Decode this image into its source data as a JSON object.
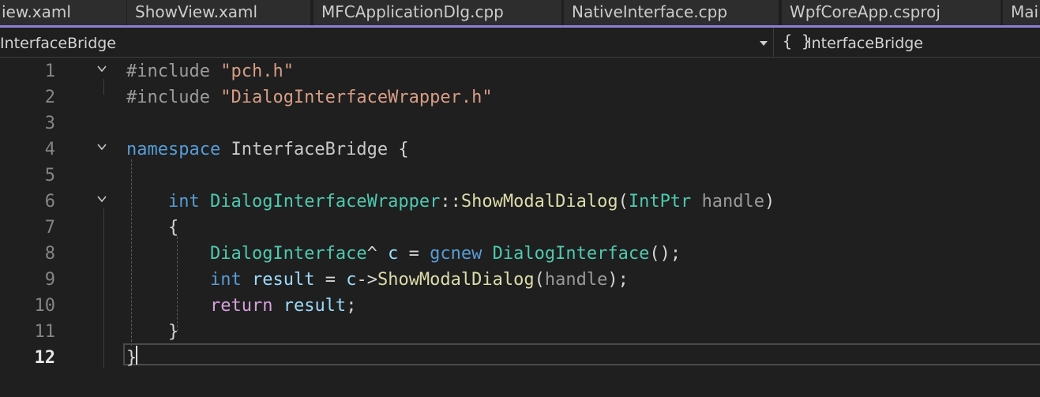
{
  "tabs": [
    {
      "label": "iew.xaml"
    },
    {
      "label": "ShowView.xaml"
    },
    {
      "label": "MFCApplicationDlg.cpp"
    },
    {
      "label": "NativeInterface.cpp"
    },
    {
      "label": "WpfCoreApp.csproj"
    },
    {
      "label": "Mai"
    }
  ],
  "navbar": {
    "scope": "InterfaceBridge",
    "member": "InterfaceBridge",
    "namespace_icon": "{ }"
  },
  "lines": {
    "n1": "1",
    "n2": "2",
    "n3": "3",
    "n4": "4",
    "n5": "5",
    "n6": "6",
    "n7": "7",
    "n8": "8",
    "n9": "9",
    "n10": "10",
    "n11": "11",
    "n12": "12"
  },
  "code": {
    "l1_directive": "#include",
    "l1_file": "\"pch.h\"",
    "l2_directive": "#include",
    "l2_file": "\"DialogInterfaceWrapper.h\"",
    "l4_keyword": "namespace",
    "l4_name": "InterfaceBridge",
    "l4_brace": "{",
    "l6_type": "int",
    "l6_class": "DialogInterfaceWrapper",
    "l6_scope": "::",
    "l6_method": "ShowModalDialog",
    "l6_open": "(",
    "l6_ptype": "IntPtr",
    "l6_param": "handle",
    "l6_close": ")",
    "l7_brace": "{",
    "l8_class": "DialogInterface",
    "l8_hat": "^",
    "l8_var": "c",
    "l8_eq": "=",
    "l8_gcnew": "gcnew",
    "l8_ctor": "DialogInterface",
    "l8_end": "();",
    "l9_type": "int",
    "l9_var": "result",
    "l9_eq": "=",
    "l9_obj": "c",
    "l9_arrow": "->",
    "l9_method": "ShowModalDialog",
    "l9_open": "(",
    "l9_arg": "handle",
    "l9_end": ");",
    "l10_return": "return",
    "l10_var": "result",
    "l10_semi": ";",
    "l11_brace": "}",
    "l12_brace": "}"
  },
  "colors": {
    "background": "#1f1f1f",
    "tab_accent": "#8c7fd6",
    "keyword": "#569cd6",
    "type": "#4ec9b0",
    "function": "#dcdcaa",
    "variable": "#9cdcfe",
    "string": "#d69d85",
    "control": "#d8a0df"
  }
}
